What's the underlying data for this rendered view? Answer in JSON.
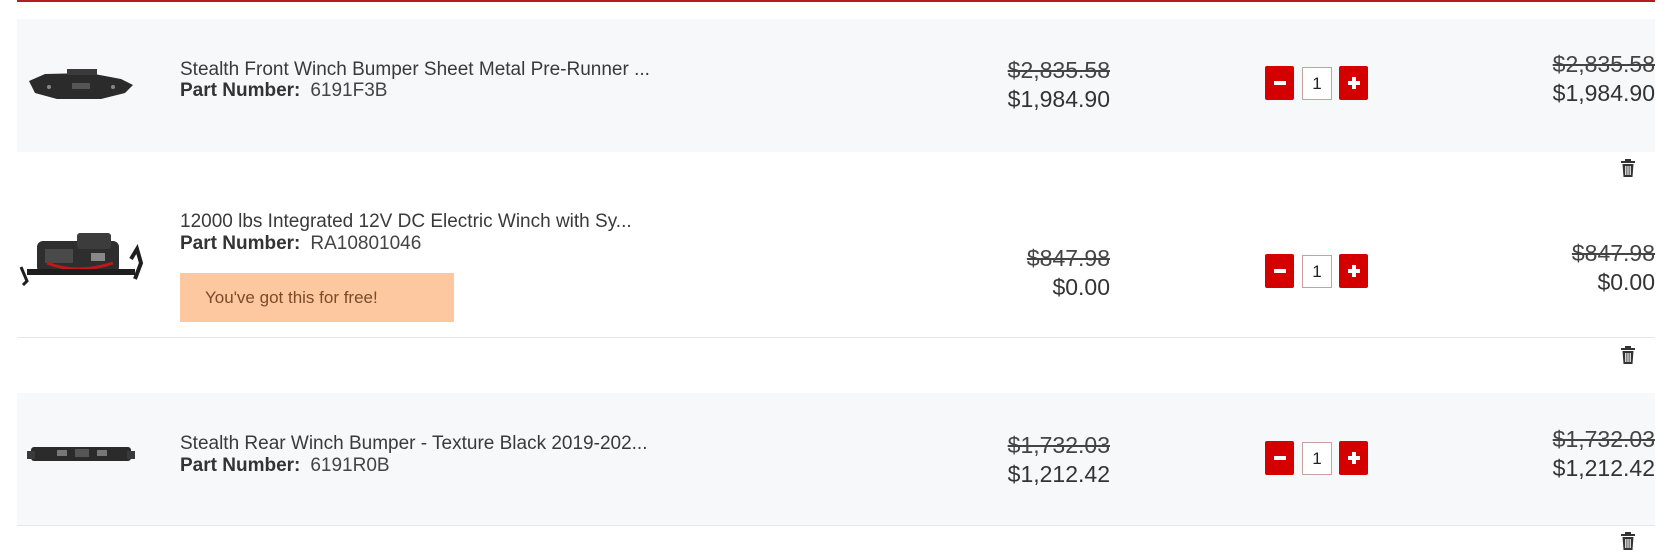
{
  "cart": {
    "items": [
      {
        "title": "Stealth Front Winch Bumper Sheet Metal Pre-Runner ...",
        "part_label": "Part Number:",
        "part_number": "6191F3B",
        "unit_price_original": "$2,835.58",
        "unit_price": "$1,984.90",
        "quantity": "1",
        "total_original": "$2,835.58",
        "total": "$1,984.90",
        "free_badge": null,
        "image_icon": "front-bumper-icon"
      },
      {
        "title": "12000 lbs Integrated 12V DC Electric Winch with Sy...",
        "part_label": "Part Number:",
        "part_number": "RA10801046",
        "unit_price_original": "$847.98",
        "unit_price": "$0.00",
        "quantity": "1",
        "total_original": "$847.98",
        "total": "$0.00",
        "free_badge": "You've got this for free!",
        "image_icon": "electric-winch-icon"
      },
      {
        "title": "Stealth Rear Winch Bumper - Texture Black 2019-202...",
        "part_label": "Part Number:",
        "part_number": "6191R0B",
        "unit_price_original": "$1,732.03",
        "unit_price": "$1,212.42",
        "quantity": "1",
        "total_original": "$1,732.03",
        "total": "$1,212.42",
        "free_badge": null,
        "image_icon": "rear-bumper-icon"
      }
    ]
  },
  "colors": {
    "accent_red": "#d40000",
    "top_rule": "#b11d21",
    "free_badge_bg": "#fdc8a0",
    "row_alt_bg": "#f7f8f9"
  },
  "icons": {
    "minus": "minus-icon",
    "plus": "plus-icon",
    "trash": "trash-icon"
  }
}
